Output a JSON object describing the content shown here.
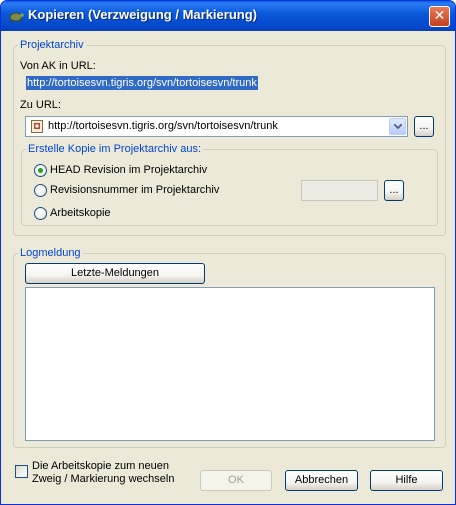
{
  "window": {
    "title": "Kopieren (Verzweigung / Markierung)",
    "title_icon": "tortoise-icon",
    "close_icon": "close-icon"
  },
  "repository": {
    "legend": "Projektarchiv",
    "from_label": "Von AK in URL:",
    "from_url": "http://tortoisesvn.tigris.org/svn/tortoisesvn/trunk",
    "to_label": "Zu URL:",
    "to_url": "http://tortoisesvn.tigris.org/svn/tortoisesvn/trunk",
    "browse_label": "...",
    "copy_source": {
      "legend": "Erstelle Kopie im Projektarchiv aus:",
      "options": [
        {
          "label": "HEAD Revision im Projektarchiv",
          "selected": true
        },
        {
          "label": "Revisionsnummer im Projektarchiv",
          "selected": false
        },
        {
          "label": "Arbeitskopie",
          "selected": false
        }
      ],
      "revision_value": "",
      "revision_browse_label": "..."
    }
  },
  "log": {
    "legend": "Logmeldung",
    "recent_button": "Letzte-Meldungen",
    "message": ""
  },
  "switch_checkbox": {
    "label_line1": "Die Arbeitskopie zum neuen",
    "label_line2": "Zweig / Markierung wechseln",
    "checked": false
  },
  "buttons": {
    "ok": "OK",
    "cancel": "Abbrechen",
    "help": "Hilfe"
  },
  "colors": {
    "titlebar": "#0a5fe8",
    "legend_text": "#0046d5",
    "selection": "#316ac5",
    "radio_dot": "#21a121"
  }
}
